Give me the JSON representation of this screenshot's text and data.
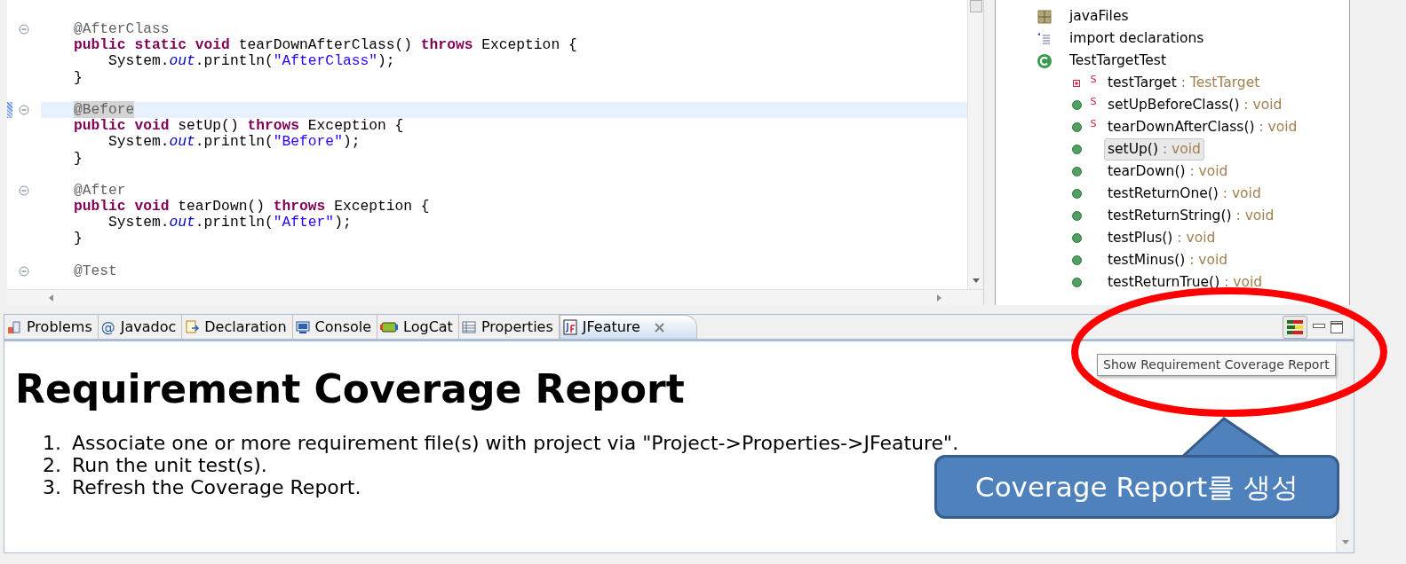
{
  "editor": {
    "lines": [
      {
        "kind": "code",
        "fold": true,
        "highlighted": false,
        "tokens": [
          {
            "kind": "annotation",
            "text": "@AfterClass"
          }
        ]
      },
      {
        "kind": "code",
        "fold": false,
        "highlighted": false,
        "tokens": [
          {
            "kind": "keyword",
            "text": "public static void"
          },
          {
            "kind": "plain",
            "text": " tearDownAfterClass() "
          },
          {
            "kind": "keyword",
            "text": "throws"
          },
          {
            "kind": "plain",
            "text": " Exception {"
          }
        ]
      },
      {
        "kind": "code",
        "fold": false,
        "highlighted": false,
        "tokens": [
          {
            "kind": "plain",
            "text": "    System."
          },
          {
            "kind": "field",
            "text": "out"
          },
          {
            "kind": "plain",
            "text": ".println("
          },
          {
            "kind": "string",
            "text": "\"AfterClass\""
          },
          {
            "kind": "plain",
            "text": ");"
          }
        ]
      },
      {
        "kind": "code",
        "fold": false,
        "highlighted": false,
        "tokens": [
          {
            "kind": "plain",
            "text": "}"
          }
        ]
      },
      {
        "kind": "blank"
      },
      {
        "kind": "code",
        "fold": true,
        "highlighted": true,
        "tokens": [
          {
            "kind": "annotation-selected",
            "text": "@Before"
          }
        ]
      },
      {
        "kind": "code",
        "fold": false,
        "highlighted": false,
        "tokens": [
          {
            "kind": "keyword",
            "text": "public void"
          },
          {
            "kind": "plain",
            "text": " setUp() "
          },
          {
            "kind": "keyword",
            "text": "throws"
          },
          {
            "kind": "plain",
            "text": " Exception {"
          }
        ]
      },
      {
        "kind": "code",
        "fold": false,
        "highlighted": false,
        "tokens": [
          {
            "kind": "plain",
            "text": "    System."
          },
          {
            "kind": "field",
            "text": "out"
          },
          {
            "kind": "plain",
            "text": ".println("
          },
          {
            "kind": "string",
            "text": "\"Before\""
          },
          {
            "kind": "plain",
            "text": ");"
          }
        ]
      },
      {
        "kind": "code",
        "fold": false,
        "highlighted": false,
        "tokens": [
          {
            "kind": "plain",
            "text": "}"
          }
        ]
      },
      {
        "kind": "blank"
      },
      {
        "kind": "code",
        "fold": true,
        "highlighted": false,
        "tokens": [
          {
            "kind": "annotation",
            "text": "@After"
          }
        ]
      },
      {
        "kind": "code",
        "fold": false,
        "highlighted": false,
        "tokens": [
          {
            "kind": "keyword",
            "text": "public void"
          },
          {
            "kind": "plain",
            "text": " tearDown() "
          },
          {
            "kind": "keyword",
            "text": "throws"
          },
          {
            "kind": "plain",
            "text": " Exception {"
          }
        ]
      },
      {
        "kind": "code",
        "fold": false,
        "highlighted": false,
        "tokens": [
          {
            "kind": "plain",
            "text": "    System."
          },
          {
            "kind": "field",
            "text": "out"
          },
          {
            "kind": "plain",
            "text": ".println("
          },
          {
            "kind": "string",
            "text": "\"After\""
          },
          {
            "kind": "plain",
            "text": ");"
          }
        ]
      },
      {
        "kind": "code",
        "fold": false,
        "highlighted": false,
        "tokens": [
          {
            "kind": "plain",
            "text": "}"
          }
        ]
      },
      {
        "kind": "blank"
      },
      {
        "kind": "code",
        "fold": true,
        "highlighted": false,
        "tokens": [
          {
            "kind": "annotation",
            "text": "@Test"
          }
        ]
      }
    ]
  },
  "outline": {
    "items": [
      {
        "kind": "package",
        "name": "javaFiles",
        "selected": false
      },
      {
        "kind": "imports",
        "name": "import declarations",
        "selected": false
      },
      {
        "kind": "class",
        "name": "TestTargetTest",
        "selected": false,
        "children": [
          {
            "kind": "field",
            "static_mark": "S",
            "name": "testTarget",
            "type": " : TestTarget",
            "selected": false
          },
          {
            "kind": "method",
            "static_mark": "S",
            "name": "setUpBeforeClass()",
            "type": " : void",
            "selected": false
          },
          {
            "kind": "method",
            "static_mark": "S",
            "name": "tearDownAfterClass()",
            "type": " : void",
            "selected": false
          },
          {
            "kind": "method",
            "name": "setUp()",
            "type": " : void",
            "selected": true
          },
          {
            "kind": "method",
            "name": "tearDown()",
            "type": " : void",
            "selected": false
          },
          {
            "kind": "method",
            "name": "testReturnOne()",
            "type": " : void",
            "selected": false
          },
          {
            "kind": "method",
            "name": "testReturnString()",
            "type": " : void",
            "selected": false
          },
          {
            "kind": "method",
            "name": "testPlus()",
            "type": " : void",
            "selected": false
          },
          {
            "kind": "method",
            "name": "testMinus()",
            "type": " : void",
            "selected": false
          },
          {
            "kind": "method",
            "name": "testReturnTrue()",
            "type": " : void",
            "selected": false
          }
        ]
      }
    ]
  },
  "panel": {
    "tabs": [
      {
        "label": "Problems",
        "selected": false,
        "closable": false
      },
      {
        "glyph": "@",
        "label": "Javadoc",
        "selected": false,
        "closable": false
      },
      {
        "label": "Declaration",
        "selected": false,
        "closable": false
      },
      {
        "label": "Console",
        "selected": false,
        "closable": false
      },
      {
        "label": "LogCat",
        "selected": false,
        "closable": false
      },
      {
        "label": "Properties",
        "selected": false,
        "closable": false
      },
      {
        "label": "JFeature",
        "selected": true,
        "closable": true
      }
    ],
    "tooltip": "Show Requirement Coverage Report",
    "report": {
      "title": "Requirement Coverage Report",
      "steps": [
        {
          "number": "1.",
          "text": "Associate one or more requirement file(s) with project via \"Project->Properties->JFeature\"."
        },
        {
          "number": "2.",
          "text": "Run the unit test(s)."
        },
        {
          "number": "3.",
          "text": "Refresh the Coverage Report."
        }
      ]
    }
  },
  "annotation": {
    "callout": "Coverage Report를 생성"
  }
}
